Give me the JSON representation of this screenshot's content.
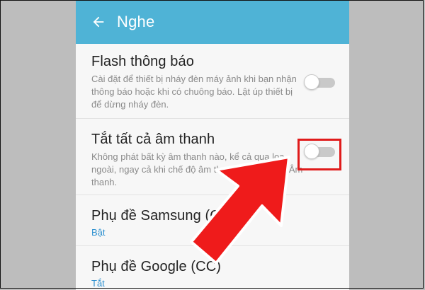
{
  "appbar": {
    "title": "Nghe",
    "back_icon": "arrow-left-icon"
  },
  "settings": [
    {
      "title": "Flash thông báo",
      "description": "Cài đặt để thiết bị nháy đèn máy ảnh khi bạn nhận thông báo hoặc khi có chuông báo. Lật úp thiết bị để dừng nháy đèn.",
      "toggle": "off"
    },
    {
      "title": "Tắt tất cả âm thanh",
      "description": "Không phát bất kỳ âm thanh nào, kể cả qua loa ngoài, ngay cả khi chế độ âm thanh được đặt là Âm thanh.",
      "toggle": "off"
    },
    {
      "title": "Phụ đề Samsung (CC)",
      "value": "Bật"
    },
    {
      "title": "Phụ đề Google (CC)",
      "value": "Tắt"
    }
  ],
  "colors": {
    "appbar": "#4fb3d6",
    "value_text": "#2b8fcf",
    "highlight": "#e01b1b"
  },
  "annotation": {
    "highlight_target": "toggle-mute-all",
    "arrow_icon": "red-arrow-icon"
  }
}
